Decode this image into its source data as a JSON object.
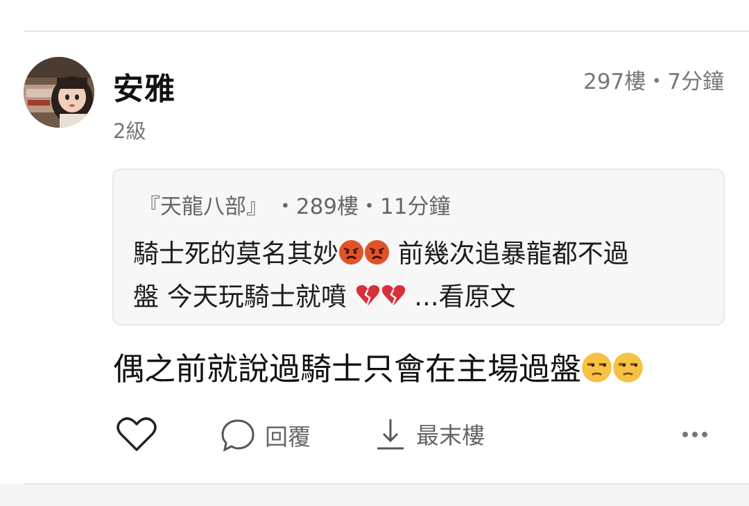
{
  "post": {
    "author": "安雅",
    "level": "2級",
    "meta": "297樓・7分鐘"
  },
  "quote": {
    "header": "『天龍八部』 ・289樓・11分鐘",
    "line1_a": "騎士死的莫名其妙",
    "line1_b": " 前幾次追暴龍都不過",
    "line2_a": "盤 今天玩騎士就噴 ",
    "line2_b": " ...看原文"
  },
  "reply": {
    "text": "偶之前就說過騎士只會在主場過盤"
  },
  "actions": {
    "reply_label": "回覆",
    "last_floor_label": "最末樓"
  },
  "icons": {
    "like": "heart-icon",
    "reply": "speech-bubble-icon",
    "last": "arrow-down-icon",
    "more": "more-dots-icon",
    "angry": "angry-face-emoji",
    "broken_heart": "broken-heart-emoji",
    "unamused": "unamused-face-emoji"
  },
  "colors": {
    "meta_gray": "#777777",
    "quote_bg": "#f7f7f7",
    "divider": "#e6e6e6"
  }
}
